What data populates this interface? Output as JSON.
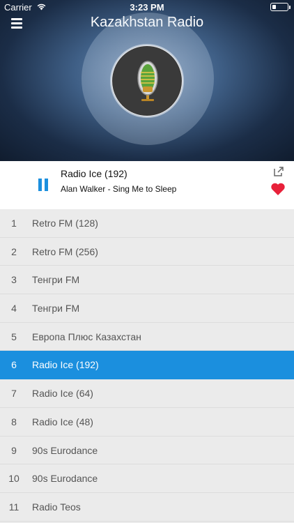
{
  "status_bar": {
    "carrier": "Carrier",
    "time": "3:23 PM"
  },
  "header": {
    "title": "Kazakhstan Radio"
  },
  "now_playing": {
    "station": "Radio Ice (192)",
    "track": "Alan Walker - Sing Me to Sleep"
  },
  "stations": [
    {
      "num": "1",
      "name": "Retro FM (128)"
    },
    {
      "num": "2",
      "name": "Retro FM (256)"
    },
    {
      "num": "3",
      "name": "Тенгри FM"
    },
    {
      "num": "4",
      "name": "Тенгри FM"
    },
    {
      "num": "5",
      "name": "Европа Плюс Казахстан"
    },
    {
      "num": "6",
      "name": "Radio Ice (192)"
    },
    {
      "num": "7",
      "name": "Radio Ice (64)"
    },
    {
      "num": "8",
      "name": "Radio Ice (48)"
    },
    {
      "num": "9",
      "name": "90s Eurodance"
    },
    {
      "num": "10",
      "name": "90s Eurodance"
    },
    {
      "num": "11",
      "name": "Radio Teos"
    }
  ],
  "active_station_index": 5,
  "colors": {
    "accent": "#1b8fde",
    "favorite": "#e8213a"
  },
  "icons": [
    "menu-icon",
    "wifi-icon",
    "battery-icon",
    "microphone-icon",
    "pause-icon",
    "share-icon",
    "heart-icon"
  ]
}
